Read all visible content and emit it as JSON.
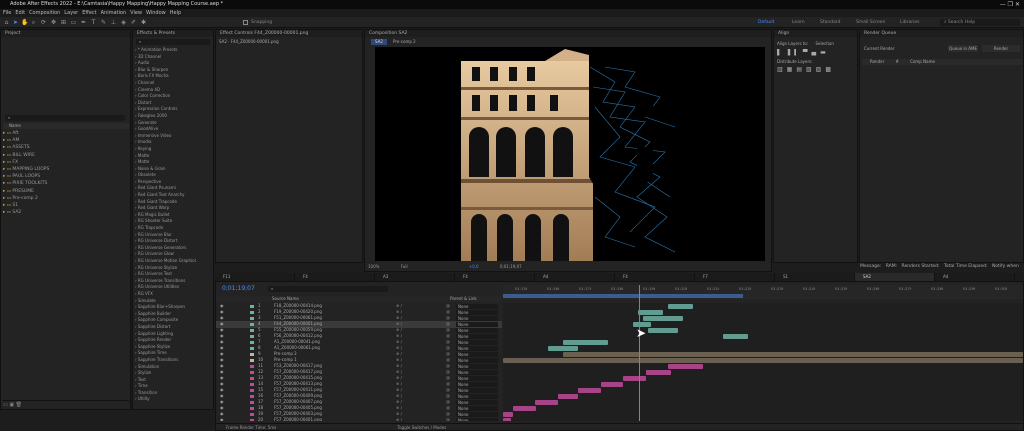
{
  "app": {
    "title": "Adobe After Effects 2022 - E:\\Camtasia\\Happy Mapping\\Happy Mapping Course.aep *"
  },
  "menu": [
    "File",
    "Edit",
    "Composition",
    "Layer",
    "Effect",
    "Animation",
    "View",
    "Window",
    "Help"
  ],
  "toolbar": {
    "snapping": "Snapping",
    "workspaces": [
      "Default",
      "Learn",
      "Standard",
      "Small Screen",
      "Libraries"
    ],
    "search_placeholder": "Search Help"
  },
  "project": {
    "tab": "Project",
    "search_placeholder": "",
    "col_name": "Name",
    "items": [
      "Aft",
      "AM",
      "ASSETS",
      "BILL WIRE",
      "FX",
      "MAPPING LOOPS",
      "PAUL LOOPS",
      "PIXIE TOOLKITS",
      "PRESUME",
      "Pre-comp 2",
      "S1",
      "SA2"
    ]
  },
  "effects": {
    "tab": "Effects & Presets",
    "search_placeholder": "",
    "items": [
      "* Animation Presets",
      "3D Channel",
      "Audio",
      "Blur & Sharpen",
      "Boris FX Mocha",
      "Channel",
      "Cinema 4D",
      "Color Correction",
      "Distort",
      "Expression Controls",
      "Fakegleo 2000",
      "Generate",
      "GoodAlive",
      "Immersive Video",
      "Imodia",
      "Keying",
      "Matte",
      "Matte",
      "Noise & Grain",
      "Obsolete",
      "Perspective",
      "Red Giant Psunami",
      "Red Giant Text Anarchy",
      "Red Giant Trapcode",
      "Red Giant Warp",
      "RG Magic Bullet",
      "RG Shooter Suite",
      "RG Trapcode",
      "RG Universe Blur",
      "RG Universe Distort",
      "RG Universe Generators",
      "RG Universe Glow",
      "RG Universe Motion Graphics",
      "RG Universe Stylize",
      "RG Universe Text",
      "RG Universe Transitions",
      "RG Universe Utilities",
      "RG VFX",
      "Simulate",
      "Sapphire Blur+Sharpen",
      "Sapphire Builder",
      "Sapphire Composite",
      "Sapphire Distort",
      "Sapphire Lighting",
      "Sapphire Render",
      "Sapphire Stylize",
      "Sapphire Time",
      "Sapphire Transitions",
      "Simulation",
      "Stylize",
      "Text",
      "Time",
      "Transition",
      "Utility"
    ]
  },
  "effect_controls": {
    "tab": "Effect Controls F44_Z00000-00001.png",
    "sub": "SA2 · F44_Z00000-00001.png"
  },
  "composition": {
    "tab": "Composition SA2",
    "sub_tabs": [
      "SA2",
      "Pre-comp 2"
    ],
    "zoom": "100%",
    "quality": "Full",
    "timecode": "0;01;19;07",
    "view": "+0.0"
  },
  "align": {
    "tab": "Align",
    "align_to_label": "Align Layers to:",
    "align_to_value": "Selection",
    "distribute": "Distribute Layers:"
  },
  "render": {
    "tab": "Render Queue",
    "current": "Current Render",
    "cols": [
      "Render",
      "#",
      "Comp Name"
    ],
    "buttons": [
      "Queue in AME",
      "Render"
    ],
    "message": "Message:",
    "ram": "RAM:",
    "started": "Renders Started:",
    "elapsed": "Total Time Elapsed:",
    "notify": "Notify when"
  },
  "timeline": {
    "tabs": [
      "F11",
      "F4",
      "A3",
      "F4",
      "A4",
      "F4",
      "F7",
      "S1",
      "SA2",
      "A4"
    ],
    "timecode": "0;01;19;07",
    "search_placeholder": "",
    "col_source": "Source Name",
    "col_parent": "Parent & Link",
    "ruler": [
      "01:15f",
      "01:16f",
      "01:17f",
      "01:18f",
      "01:19f",
      "01:20f",
      "01:21f",
      "01:22f",
      "01:23f",
      "01:24f",
      "01:25f",
      "01:26f",
      "01:27f",
      "01:28f",
      "01:29f",
      "01:30f"
    ],
    "footer": "Frame Render Time: 5ms",
    "footer2": "Toggle Switches / Modes",
    "layers": [
      {
        "num": "1",
        "name": "F18_Z00000-00414.png",
        "parent": "None",
        "color": "#6fb2a5"
      },
      {
        "num": "2",
        "name": "F19_Z00000-00420.png",
        "parent": "None",
        "color": "#6fb2a5"
      },
      {
        "num": "3",
        "name": "F51_Z00000-00061.png",
        "parent": "None",
        "color": "#6fb2a5"
      },
      {
        "num": "4",
        "name": "F44_Z00000-00001.png",
        "parent": "None",
        "color": "#6fb2a5"
      },
      {
        "num": "5",
        "name": "F55_Z00000-00059.png",
        "parent": "None",
        "color": "#6fb2a5"
      },
      {
        "num": "6",
        "name": "F56_Z00000-00412.png",
        "parent": "None",
        "color": "#6fb2a5"
      },
      {
        "num": "7",
        "name": "A1_Z00000-00041.png",
        "parent": "None",
        "color": "#6fb2a5"
      },
      {
        "num": "8",
        "name": "A1_Z00000-00061.png",
        "parent": "None",
        "color": "#6fb2a5"
      },
      {
        "num": "9",
        "name": "Pre-comp 2",
        "parent": "None",
        "color": "#c6b49a"
      },
      {
        "num": "10",
        "name": "Pre-comp 1",
        "parent": "None",
        "color": "#c6b49a"
      },
      {
        "num": "11",
        "name": "F53_Z00000-00417.png",
        "parent": "None",
        "color": "#c04a9a"
      },
      {
        "num": "12",
        "name": "F57_Z00000-00417.png",
        "parent": "None",
        "color": "#c04a9a"
      },
      {
        "num": "13",
        "name": "F57_Z00000-00415.png",
        "parent": "None",
        "color": "#c04a9a"
      },
      {
        "num": "14",
        "name": "F57_Z00000-00413.png",
        "parent": "None",
        "color": "#c04a9a"
      },
      {
        "num": "15",
        "name": "F57_Z00000-00411.png",
        "parent": "None",
        "color": "#c04a9a"
      },
      {
        "num": "16",
        "name": "F57_Z00000-00409.png",
        "parent": "None",
        "color": "#c04a9a"
      },
      {
        "num": "17",
        "name": "F57_Z00000-00407.png",
        "parent": "None",
        "color": "#c04a9a"
      },
      {
        "num": "18",
        "name": "F57_Z00000-00405.png",
        "parent": "None",
        "color": "#c04a9a"
      },
      {
        "num": "19",
        "name": "F57_Z00000-00403.png",
        "parent": "None",
        "color": "#c04a9a"
      },
      {
        "num": "20",
        "name": "F57_Z00000-00401.png",
        "parent": "None",
        "color": "#c04a9a"
      }
    ]
  }
}
